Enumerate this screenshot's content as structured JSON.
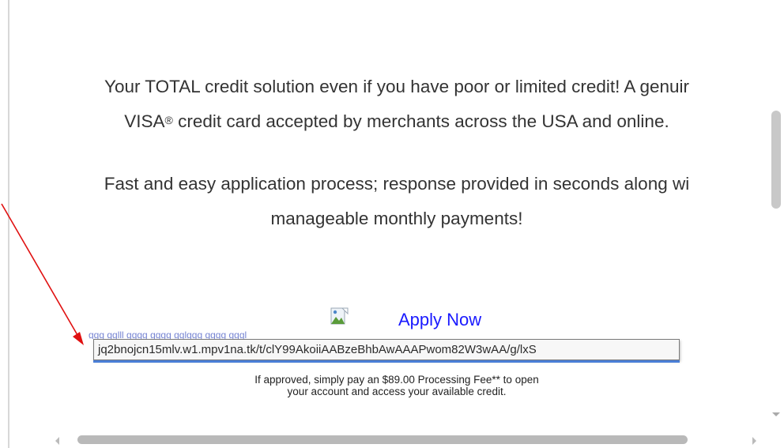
{
  "offer": {
    "line1": "Your TOTAL credit solution even if you have poor or limited credit! A genuir",
    "line2_pre": "VISA",
    "line2_reg": "®",
    "line2_post": " credit card accepted by merchants across the USA and online.",
    "line3": "Fast and easy application process; response provided in seconds along wi",
    "line4": "manageable monthly payments!"
  },
  "apply": {
    "link_label": "Apply Now",
    "hidden_text": "ggg   gglll   gggg   gggg       gglggg gggg gggl"
  },
  "tooltip": {
    "url": "jq2bnojcn15mlv.w1.mpv1na.tk/t/clY99AkoiiAABzeBhbAwAAAPwom82W3wAA/g/lxS"
  },
  "fee": {
    "line1": "If approved, simply pay an $89.00 Processing Fee** to open",
    "line2": "your account and access your available credit."
  },
  "colors": {
    "link": "#1a1aff",
    "annotation_arrow": "#e01010",
    "tooltip_border": "#7a7a7a"
  },
  "icons": {
    "broken_image": "broken-image-icon",
    "annotation": "red-arrow-icon"
  }
}
